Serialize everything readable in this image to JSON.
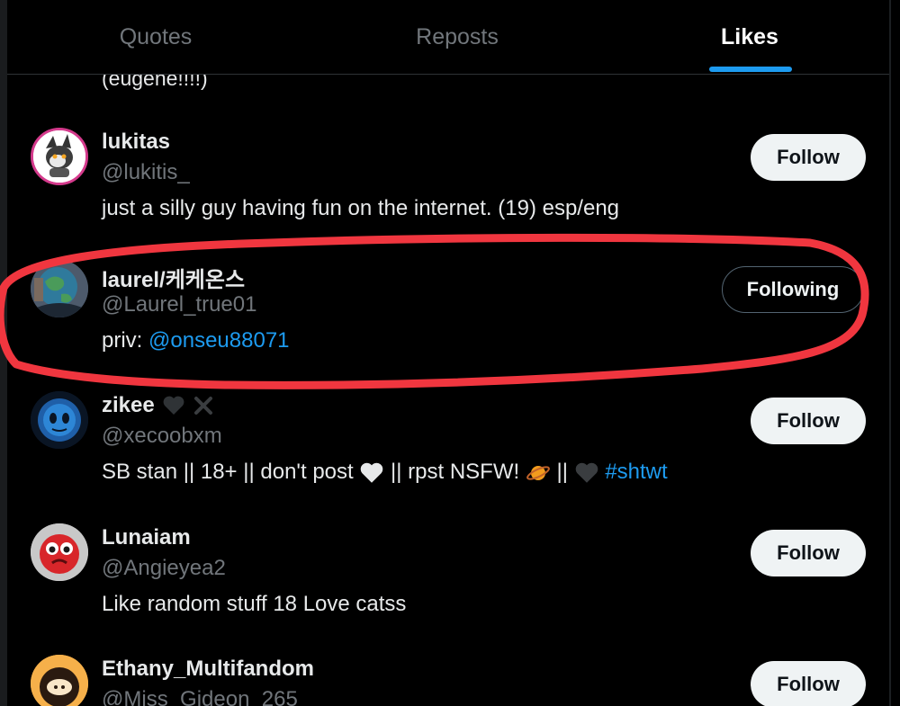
{
  "tabs": [
    {
      "label": "Quotes",
      "active": false
    },
    {
      "label": "Reposts",
      "active": false
    },
    {
      "label": "Likes",
      "active": true
    }
  ],
  "accent_color": "#1d9bf0",
  "annotation_color": "#f0363f",
  "cut_off_text": "(eugene!!!!)",
  "users": [
    {
      "name": "lukitas",
      "handle": "@lukitis_",
      "bio": "just a silly guy having fun on the internet. (19) esp/eng",
      "button": "Follow"
    },
    {
      "name": "laurel/케케온스",
      "handle": "@Laurel_true01",
      "bio_prefix": "priv: ",
      "bio_link": "@onseu88071",
      "button": "Following",
      "highlighted": true
    },
    {
      "name": "zikee",
      "name_icons": [
        "black-heart-icon",
        "x-mark-icon"
      ],
      "handle": "@xecoobxm",
      "bio_part1": "SB stan || 18+ || don't post ",
      "bio_part2": " || rpst NSFW! ",
      "bio_part3": " || ",
      "bio_hashtag": "#shtwt",
      "bio_icons": [
        "white-heart-icon",
        "ringed-planet-icon",
        "black-heart-icon"
      ],
      "button": "Follow"
    },
    {
      "name": "Lunaiam",
      "handle": "@Angieyea2",
      "bio": "Like random stuff 18 Love catss",
      "button": "Follow"
    },
    {
      "name": "Ethany_Multifandom",
      "handle": "@Miss_Gideon_265",
      "button": "Follow"
    }
  ]
}
